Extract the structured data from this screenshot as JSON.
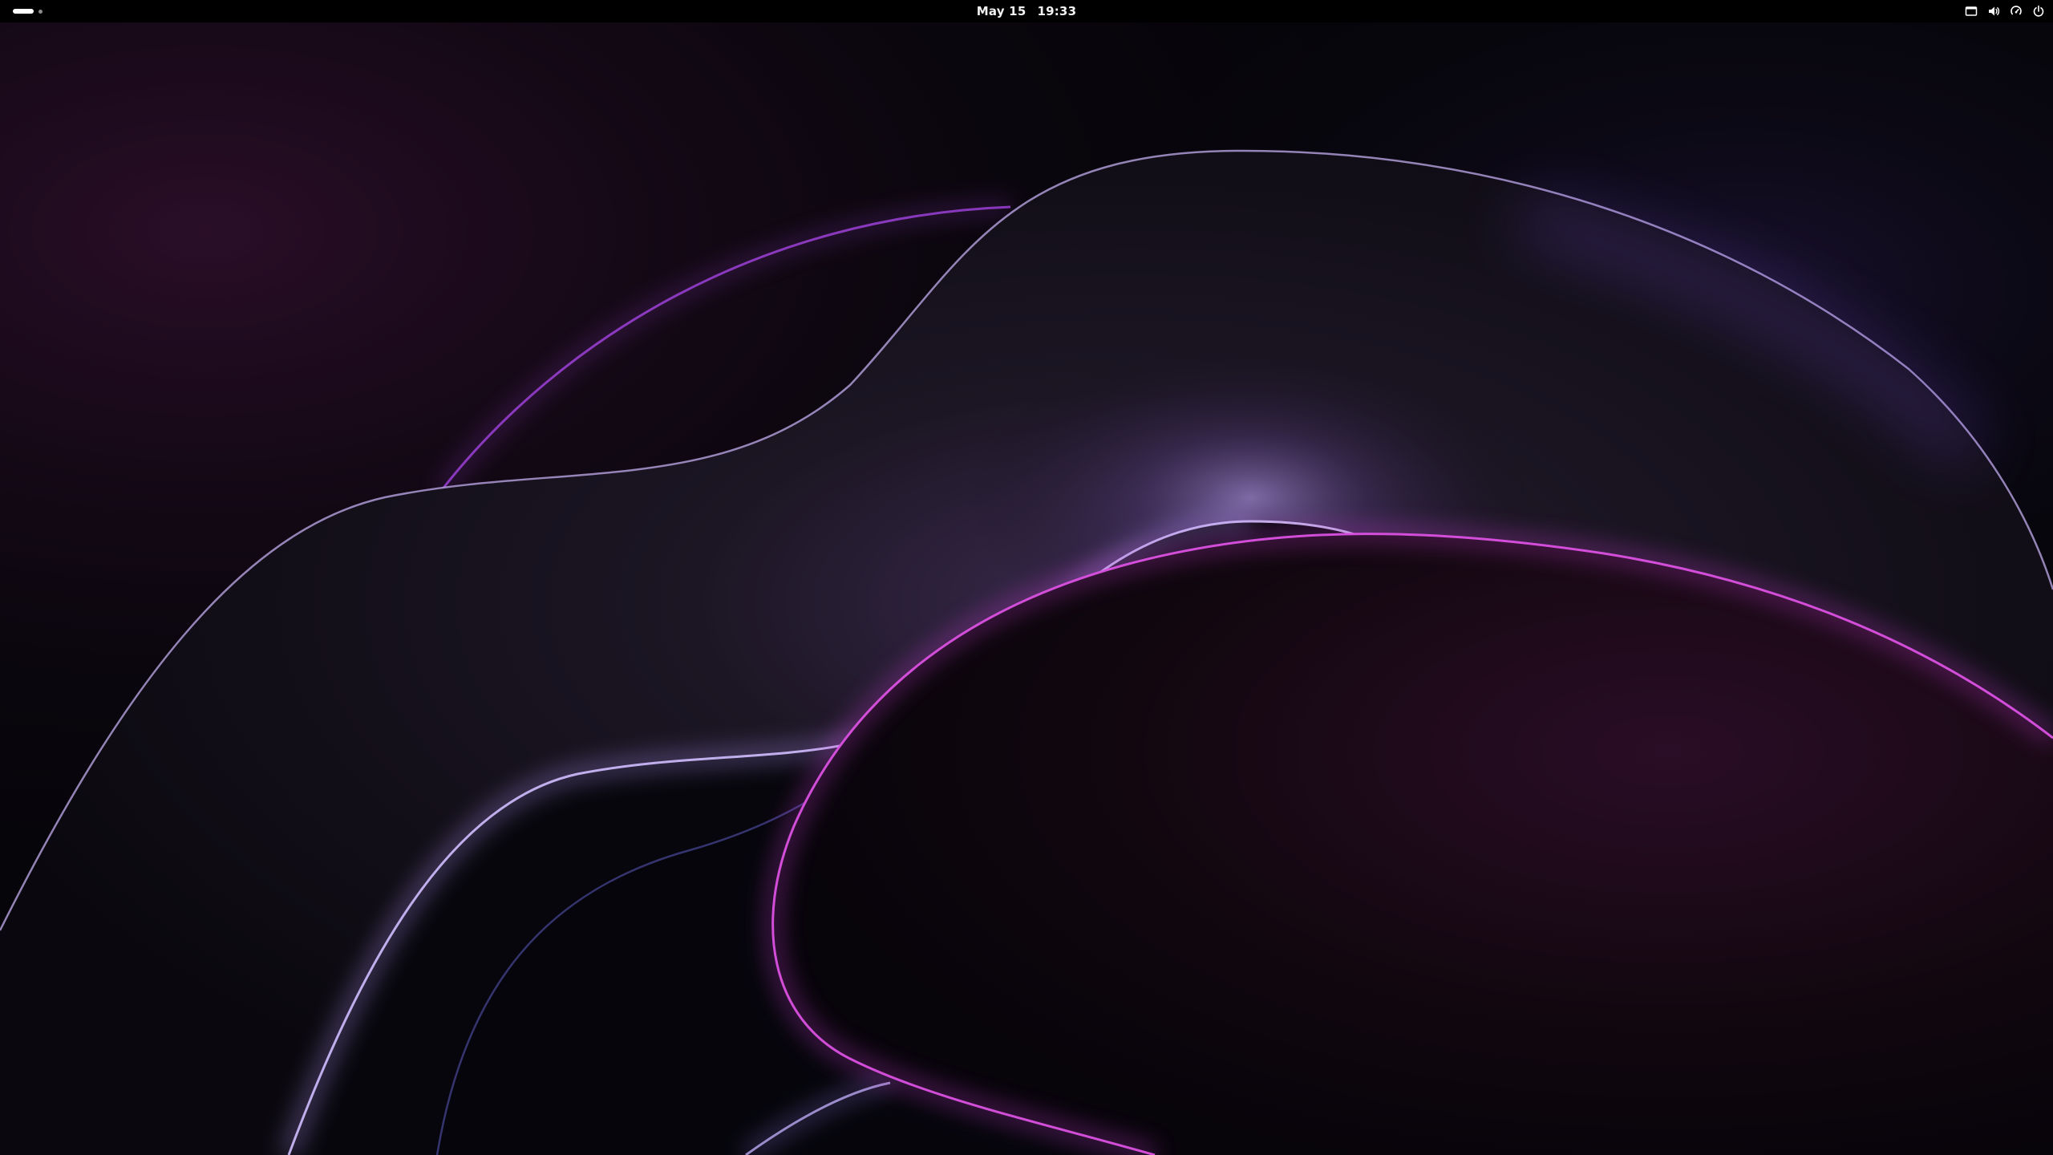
{
  "top_bar": {
    "date": "May 15",
    "time": "19:33",
    "workspaces": {
      "count": 2,
      "active": 1
    },
    "status_icons": [
      "screen-icon",
      "volume-icon",
      "network-icon",
      "power-icon"
    ]
  },
  "colors": {
    "top_bar_background": "#000000",
    "wallpaper_base": "#06050a",
    "accent_violet": "#a68bff",
    "accent_magenta": "#e055e6",
    "accent_purple": "#9a3fd6"
  }
}
